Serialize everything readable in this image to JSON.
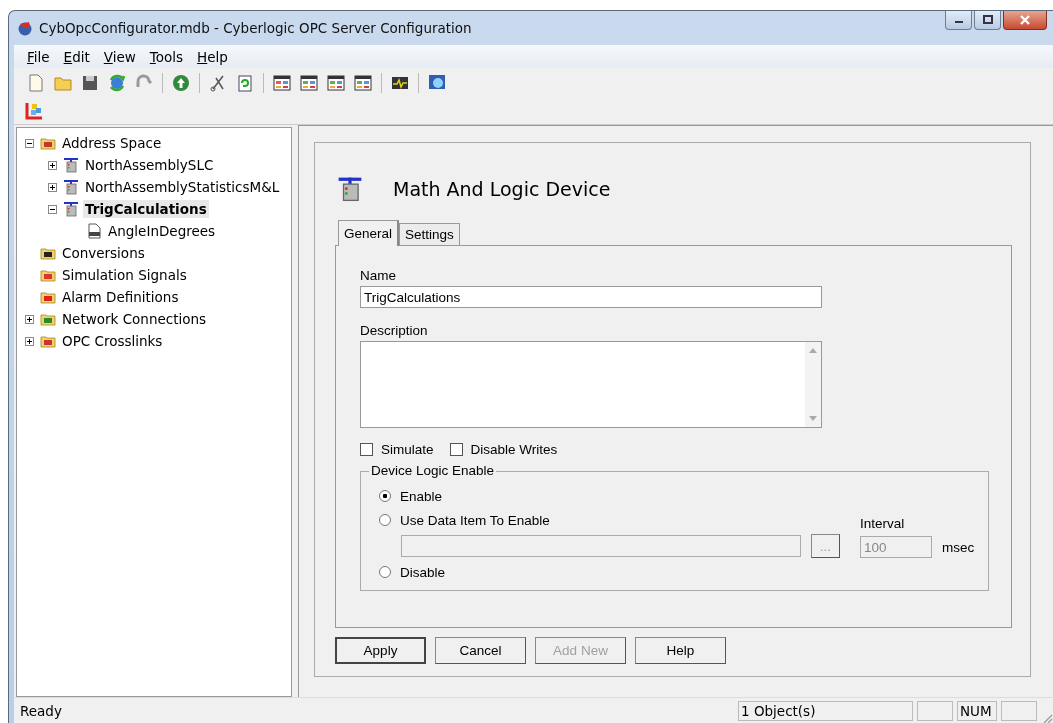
{
  "window": {
    "title": "CybOpcConfigurator.mdb - Cyberlogic OPC Server Configuration"
  },
  "menu": [
    {
      "label": "File"
    },
    {
      "label": "Edit"
    },
    {
      "label": "View"
    },
    {
      "label": "Tools"
    },
    {
      "label": "Help"
    }
  ],
  "tree": [
    {
      "label": "Address Space",
      "kind": "root",
      "expanded": true,
      "selected": false,
      "children": [
        {
          "label": "NorthAssemblySLC",
          "kind": "device",
          "expanded": false,
          "selected": false
        },
        {
          "label": "NorthAssemblyStatisticsM&L",
          "kind": "device",
          "expanded": false,
          "selected": false
        },
        {
          "label": "TrigCalculations",
          "kind": "device",
          "expanded": true,
          "selected": true,
          "children": [
            {
              "label": "AngleInDegrees",
              "kind": "tag",
              "selected": false
            }
          ]
        }
      ]
    },
    {
      "label": "Conversions",
      "kind": "conversions",
      "selected": false
    },
    {
      "label": "Simulation Signals",
      "kind": "simulation",
      "selected": false
    },
    {
      "label": "Alarm Definitions",
      "kind": "alarm",
      "selected": false
    },
    {
      "label": "Network Connections",
      "kind": "network",
      "expanded": false,
      "selected": false
    },
    {
      "label": "OPC Crosslinks",
      "kind": "crosslinks",
      "expanded": false,
      "selected": false
    }
  ],
  "editor": {
    "title": "Math And Logic Device",
    "tabs": [
      {
        "label": "General",
        "selected": true
      },
      {
        "label": "Settings",
        "selected": false
      }
    ],
    "name": {
      "label": "Name",
      "value": "TrigCalculations"
    },
    "description": {
      "label": "Description"
    },
    "checkboxes": [
      {
        "label": "Simulate",
        "checked": false
      },
      {
        "label": "Disable Writes",
        "checked": false
      }
    ],
    "logic_group": {
      "title": "Device Logic Enable",
      "radios": [
        {
          "label": "Enable",
          "selected": true
        },
        {
          "label": "Use Data Item To Enable",
          "selected": false
        },
        {
          "label": "Disable",
          "selected": false
        }
      ],
      "browse_button": {
        "label": "...",
        "disabled": true
      },
      "interval": {
        "label": "Interval",
        "value": "100",
        "unit": "msec",
        "disabled": true
      }
    },
    "buttons": [
      {
        "label": "Apply",
        "default": true,
        "disabled": false
      },
      {
        "label": "Cancel",
        "default": false,
        "disabled": false
      },
      {
        "label": "Add New",
        "default": false,
        "disabled": true
      },
      {
        "label": "Help",
        "default": false,
        "disabled": false
      }
    ]
  },
  "status_bar": {
    "message": "Ready",
    "panes": [
      "1 Object(s)",
      "NUM"
    ]
  }
}
